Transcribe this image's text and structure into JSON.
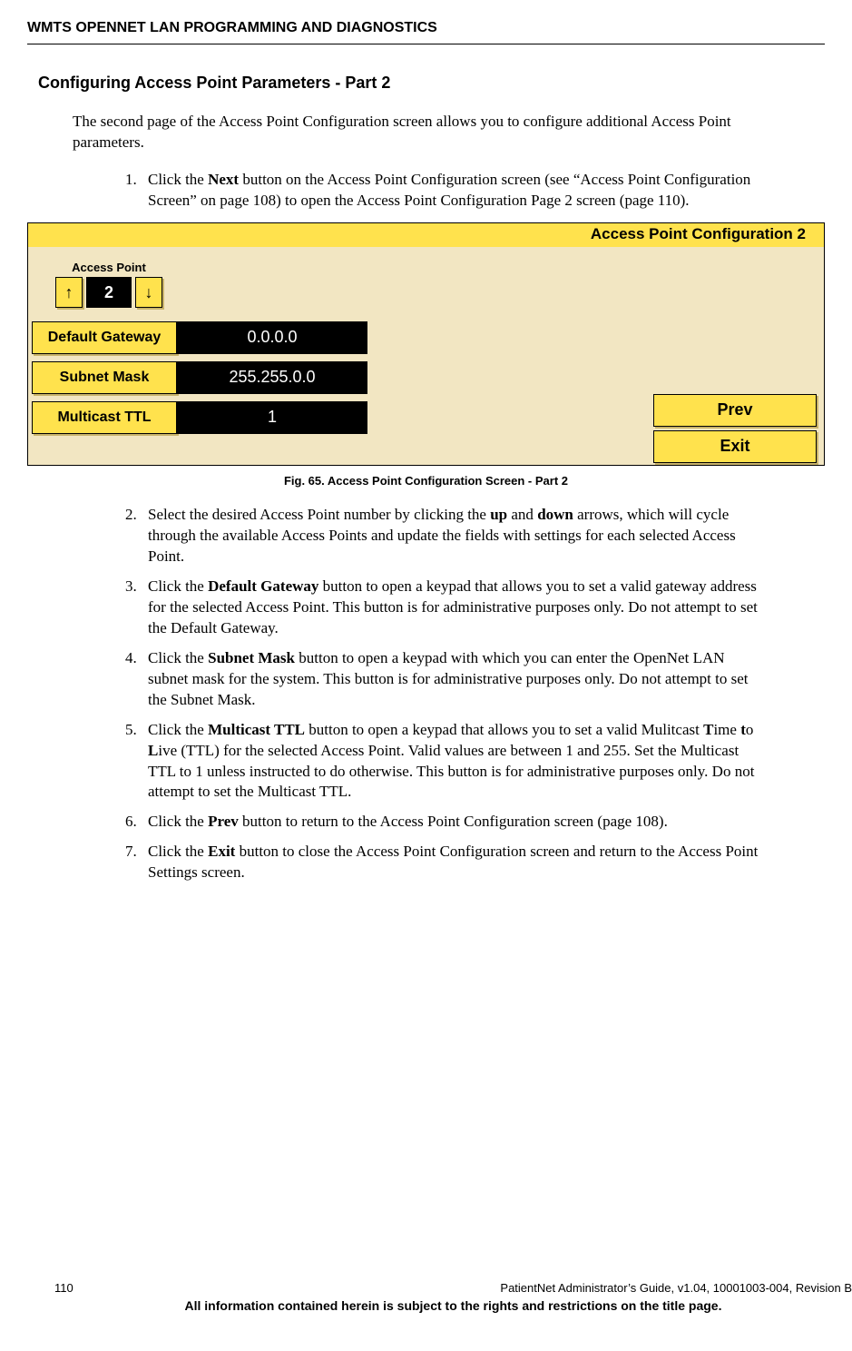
{
  "header": "WMTS OPENNET LAN PROGRAMMING AND DIAGNOSTICS",
  "section_title": "Configuring Access Point Parameters - Part 2",
  "intro": "The second page of the Access Point Configuration screen allows you to configure additional Access Point parameters.",
  "step1_a": "Click the ",
  "step1_b": "Next",
  "step1_c": " button on the Access Point Configuration screen (see “Access Point Configuration Screen” on page 108) to open the Access Point Configuration Page 2 screen (page 110).",
  "screenshot": {
    "title": "Access Point Configuration 2",
    "ap_label": "Access Point",
    "up": "↑",
    "down": "↓",
    "ap_value": "2",
    "gateway_label": "Default Gateway",
    "gateway_value": "0.0.0.0",
    "subnet_label": "Subnet Mask",
    "subnet_value": "255.255.0.0",
    "ttl_label": "Multicast TTL",
    "ttl_value": "1",
    "prev": "Prev",
    "exit": "Exit"
  },
  "fig_caption": "Fig. 65. Access Point Configuration Screen - Part 2",
  "step2_a": "Select the desired Access Point number by clicking the ",
  "step2_b": "up",
  "step2_c": " and ",
  "step2_d": "down",
  "step2_e": " arrows, which will cycle through the available Access Points and update the fields with settings for each selected Access Point.",
  "step3_a": "Click the ",
  "step3_b": "Default Gateway",
  "step3_c": " button to open a keypad that allows you to set a valid gateway address for the selected Access Point. This button is for administrative purposes only. Do not attempt to set the Default Gateway.",
  "step4_a": "Click the ",
  "step4_b": "Subnet Mask",
  "step4_c": " button to open a keypad with which you can enter the OpenNet LAN subnet mask for the system. This button is for administrative purposes only. Do not attempt to set the Subnet Mask.",
  "step5_a": "Click the ",
  "step5_b": "Multicast TTL",
  "step5_c": " button to open a keypad that allows you to set a valid Mulitcast ",
  "step5_d": "T",
  "step5_e": "ime ",
  "step5_f": "t",
  "step5_g": "o ",
  "step5_h": "L",
  "step5_i": "ive (TTL) for the selected Access Point. Valid values are between 1 and 255. Set the Multicast TTL to 1 unless instructed to do otherwise. This button is for administrative purposes only. Do not attempt to set the Multicast TTL.",
  "step6_a": "Click the ",
  "step6_b": "Prev",
  "step6_c": " button to return to the Access Point Configuration screen (page 108).",
  "step7_a": "Click the ",
  "step7_b": "Exit",
  "step7_c": " button to close the Access Point Configuration screen and return to the Access Point Settings screen.",
  "footer": {
    "page": "110",
    "right": "PatientNet Administrator’s Guide, v1.04, 10001003-004, Revision B",
    "notice": "All information contained herein is subject to the rights and restrictions on the title page."
  }
}
